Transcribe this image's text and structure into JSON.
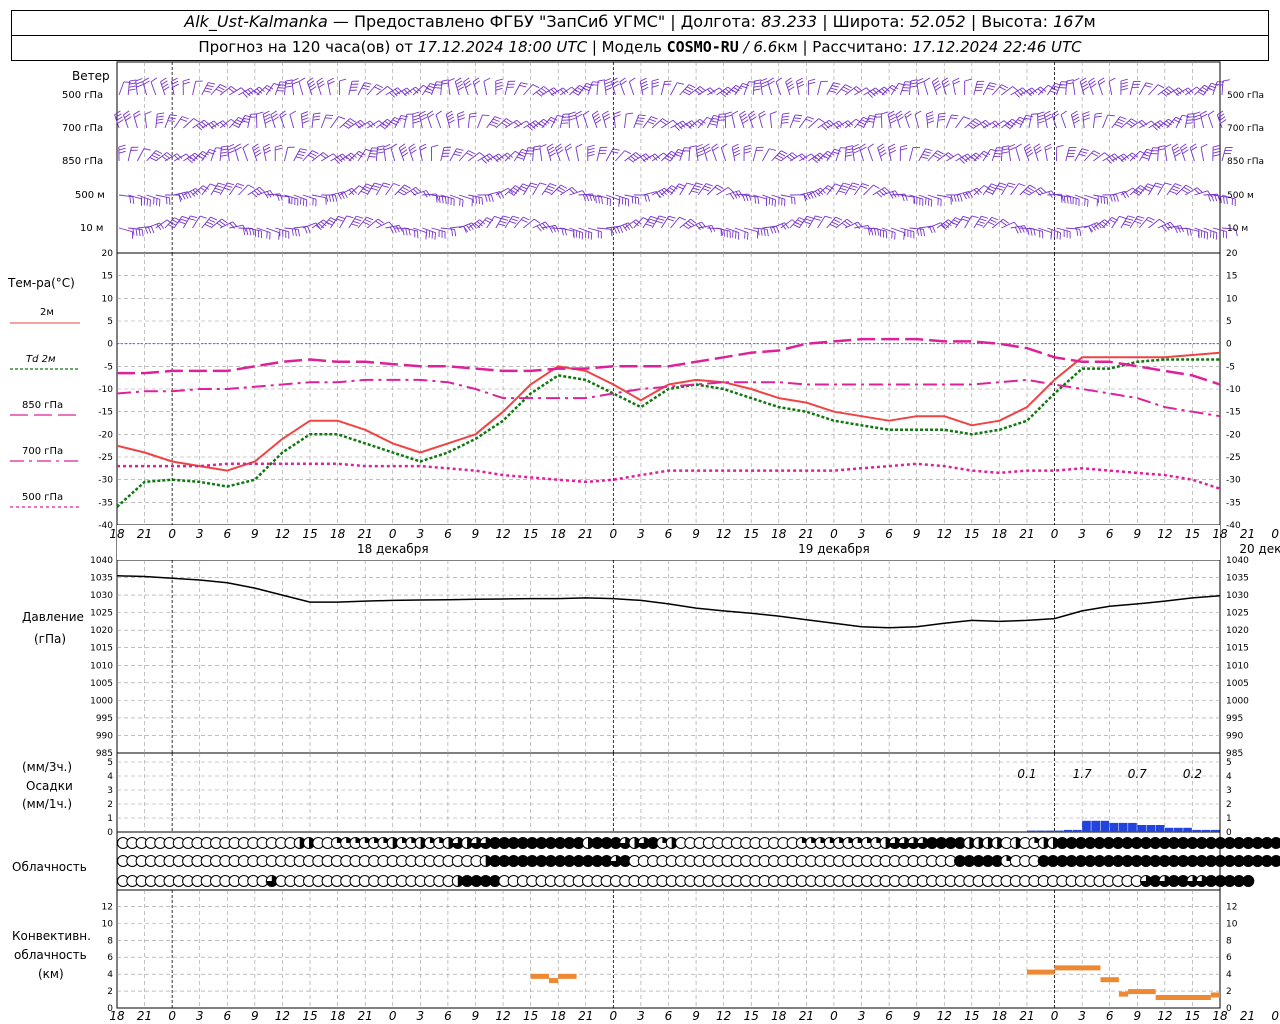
{
  "header": {
    "station": "Alk_Ust-Kalmanka",
    "provider": "— Предоставлено ФГБУ \"ЗапСиб УГМС\" |",
    "lon_label": "Долгота:",
    "lon_value": "83.233",
    "lat_label": "| Широта:",
    "lat_value": "52.052",
    "alt_label": "| Высота:",
    "alt_value": "167",
    "alt_unit": "м",
    "forecast_prefix": "Прогноз на 120 часа(ов) от",
    "forecast_time": "17.12.2024 18:00 UTC",
    "model_label": "| Модель",
    "model_name": "COSMO-RU",
    "model_res": "/ 6.6",
    "model_unit": "км",
    "calc_label": "| Рассчитано:",
    "calc_time": "17.12.2024 22:46 UTC"
  },
  "labels": {
    "wind_title": "Ветер",
    "wind_levels": [
      "500 гПа",
      "700 гПа",
      "850 гПа",
      "500 м",
      "10 м"
    ],
    "temp_title": "Тем-ра(°С)",
    "temp_legend": [
      "2м",
      "Td 2м",
      "850 гПа",
      "700 гПа",
      "500 гПа"
    ],
    "pres_title": "Давление",
    "pres_unit": "(гПа)",
    "precip_unit1": "(мм/3ч.)",
    "precip_title": "Осадки",
    "precip_unit2": "(мм/1ч.)",
    "cloud_title": "Облачность",
    "conv_title1": "Конвективн.",
    "conv_title2": "облачность",
    "conv_unit": "(км)"
  },
  "colors": {
    "t2m": "#ee4444",
    "td2m": "#117711",
    "t850": "#dd2299",
    "t700": "#dd2299",
    "t500": "#dd2299",
    "wind": "#7733cc",
    "precip": "#2244dd",
    "conv": "#ee8833",
    "zero": "#3355dd"
  },
  "chart_data": [
    {
      "type": "line",
      "name": "temperature",
      "x_hours": [
        0,
        3,
        6,
        9,
        12,
        15,
        18,
        21,
        24,
        27,
        30,
        33,
        36,
        39,
        42,
        45,
        48,
        51,
        54,
        57,
        60,
        63,
        66,
        69,
        72,
        75,
        78,
        81,
        84,
        87,
        90,
        93,
        96,
        99,
        102,
        105,
        108,
        111,
        114,
        117,
        120
      ],
      "x_tick_labels": [
        "18",
        "21",
        "0",
        "3",
        "6",
        "9",
        "12",
        "15",
        "18",
        "21",
        "0",
        "3",
        "6",
        "9",
        "12",
        "15",
        "18",
        "21",
        "0",
        "3",
        "6",
        "9",
        "12",
        "15",
        "18",
        "21",
        "0",
        "3",
        "6",
        "9",
        "12",
        "15",
        "18",
        "21",
        "0",
        "3",
        "6",
        "9",
        "12",
        "15",
        "18",
        "21",
        "0"
      ],
      "date_labels": [
        "18 декабря",
        "19 декабря",
        "20 декабря"
      ],
      "ylim": [
        -40,
        20
      ],
      "yticks": [
        20,
        15,
        10,
        5,
        0,
        -5,
        -10,
        -15,
        -20,
        -25,
        -30,
        -35,
        -40
      ],
      "series": [
        {
          "name": "2м",
          "values": [
            -22.5,
            -24,
            -26,
            -27,
            -28,
            -26,
            -21,
            -17,
            -17,
            -19,
            -22,
            -24,
            -22,
            -20,
            -15,
            -9,
            -5,
            -6,
            -9,
            -12.5,
            -9,
            -8,
            -8.5,
            -10,
            -12,
            -13,
            -15,
            -16,
            -17,
            -16,
            -16,
            -18,
            -17,
            -14,
            -8,
            -3,
            -3,
            -3,
            -3,
            -2.5,
            -2
          ]
        },
        {
          "name": "Td 2м",
          "values": [
            -36,
            -30.5,
            -30,
            -30.5,
            -31.5,
            -30,
            -24,
            -20,
            -20,
            -22,
            -24,
            -26,
            -24,
            -21,
            -17,
            -11,
            -7,
            -8,
            -11,
            -14,
            -10,
            -9,
            -10,
            -12,
            -14,
            -15,
            -17,
            -18,
            -19,
            -19,
            -19,
            -20,
            -19,
            -17,
            -11,
            -5.5,
            -5.5,
            -4,
            -3.5,
            -3.5,
            -3.5
          ]
        },
        {
          "name": "850 гПа",
          "values": [
            -6.5,
            -6.5,
            -6,
            -6,
            -6,
            -5,
            -4,
            -3.5,
            -4,
            -4,
            -4.5,
            -5,
            -5,
            -5.5,
            -6,
            -6,
            -5.5,
            -5.5,
            -5,
            -5,
            -5,
            -4,
            -3,
            -2,
            -1.5,
            0,
            0.5,
            1,
            1,
            1,
            0.5,
            0.5,
            0,
            -1,
            -3,
            -4,
            -4,
            -5,
            -6,
            -7,
            -9
          ]
        },
        {
          "name": "700 гПа",
          "values": [
            -11,
            -10.5,
            -10.5,
            -10,
            -10,
            -9.5,
            -9,
            -8.5,
            -8.5,
            -8,
            -8,
            -8,
            -8.5,
            -10,
            -12,
            -12,
            -12,
            -12,
            -11,
            -10,
            -9.5,
            -9,
            -8.5,
            -8.5,
            -8.5,
            -9,
            -9,
            -9,
            -9,
            -9,
            -9,
            -9,
            -8.5,
            -8,
            -9,
            -10,
            -11,
            -12,
            -14,
            -15,
            -16
          ]
        },
        {
          "name": "500 гПа",
          "values": [
            -27,
            -27,
            -27,
            -27,
            -26.5,
            -26.5,
            -26.5,
            -26.5,
            -26.5,
            -27,
            -27,
            -27,
            -27.5,
            -28,
            -29,
            -29.5,
            -30,
            -30.5,
            -30,
            -29,
            -28,
            -28,
            -28,
            -28,
            -28,
            -28,
            -28,
            -27.5,
            -27,
            -26.5,
            -27,
            -28,
            -28.5,
            -28,
            -28,
            -27.5,
            -28,
            -28.5,
            -29,
            -30,
            -32
          ]
        }
      ]
    },
    {
      "type": "line",
      "name": "pressure",
      "x_hours": [
        0,
        3,
        6,
        9,
        12,
        15,
        18,
        21,
        24,
        27,
        30,
        33,
        36,
        39,
        42,
        45,
        48,
        51,
        54,
        57,
        60,
        63,
        66,
        69,
        72,
        75,
        78,
        81,
        84,
        87,
        90,
        93,
        96,
        99,
        102,
        105,
        108,
        111,
        114,
        117,
        120
      ],
      "ylim": [
        985,
        1040
      ],
      "yticks": [
        1040,
        1035,
        1030,
        1025,
        1020,
        1015,
        1010,
        1005,
        1000,
        995,
        990,
        985
      ],
      "series": [
        {
          "name": "Давление",
          "values": [
            1035.5,
            1035.3,
            1034.8,
            1034.3,
            1033.5,
            1032,
            1030,
            1028,
            1028,
            1028.3,
            1028.5,
            1028.6,
            1028.7,
            1028.8,
            1028.9,
            1029,
            1029,
            1029.2,
            1029,
            1028.5,
            1027.5,
            1026.3,
            1025.5,
            1024.8,
            1024,
            1023,
            1022,
            1021,
            1020.7,
            1021,
            1022,
            1022.8,
            1022.5,
            1022.8,
            1023.3,
            1025.5,
            1026.8,
            1027.5,
            1028.3,
            1029.2,
            1029.8
          ]
        }
      ]
    },
    {
      "type": "bar",
      "name": "precipitation",
      "ylim": [
        0,
        5
      ],
      "yticks": [
        5,
        4,
        3,
        2,
        1,
        0
      ],
      "x_hours": [
        96,
        97,
        98,
        99,
        100,
        101,
        102,
        103,
        104,
        105,
        106,
        107,
        108,
        109,
        110,
        111,
        112,
        113,
        114,
        115,
        116,
        117,
        118,
        119
      ],
      "values": [
        0.05,
        0.05,
        0.05,
        0.1,
        0.1,
        0.1,
        0.1,
        0.15,
        0.15,
        0.8,
        0.8,
        0.8,
        0.65,
        0.65,
        0.65,
        0.5,
        0.5,
        0.5,
        0.3,
        0.3,
        0.3,
        0.15,
        0.15,
        0.15
      ],
      "period_totals": [
        {
          "hour": 99,
          "value": "0.1"
        },
        {
          "hour": 105,
          "value": "1.7"
        },
        {
          "hour": 111,
          "value": "0.7"
        },
        {
          "hour": 117,
          "value": "0.2"
        }
      ]
    },
    {
      "type": "table",
      "name": "cloud_cover",
      "description_rows": [
        "upper",
        "middle",
        "lower"
      ],
      "fraction_per_hour": [
        [
          0,
          0,
          0,
          0,
          0,
          0,
          0,
          0,
          0,
          0,
          0,
          0,
          0,
          0,
          0,
          0,
          0,
          0,
          0,
          0.5,
          0.5,
          0,
          0,
          0.25,
          0.25,
          0.25,
          0.25,
          0.25,
          0.25,
          0.5,
          0.25,
          0.25,
          0.5,
          0.25,
          0.25,
          0.5,
          0.75,
          0.5,
          0.75,
          0.75,
          1,
          1,
          1,
          1,
          1,
          1,
          1,
          1,
          1,
          1,
          0.5,
          1,
          1,
          1,
          0.75,
          0.5,
          0.75,
          1,
          0.25,
          0.5,
          0,
          0,
          0,
          0,
          0,
          0,
          0,
          0,
          0,
          0,
          0,
          0,
          0,
          0.25,
          0.25,
          0.25,
          0.25,
          0.25,
          0.25,
          0.25,
          0.25,
          0.25,
          0.5,
          0.75,
          0.75,
          0.75,
          0.75,
          1,
          1,
          1,
          1,
          0.5,
          0.5,
          0.5,
          0.5,
          0,
          0.5,
          0,
          0.25,
          0.5,
          0.5,
          1,
          1,
          1,
          1,
          1,
          1,
          1,
          1,
          1,
          1,
          1,
          1,
          1,
          1,
          1,
          1,
          1,
          1,
          1,
          1,
          1,
          1,
          1,
          1,
          0.5
        ],
        [
          0,
          0,
          0,
          0,
          0,
          0,
          0,
          0,
          0,
          0,
          0,
          0,
          0,
          0,
          0,
          0,
          0,
          0,
          0,
          0,
          0,
          0,
          0,
          0,
          0,
          0,
          0,
          0,
          0,
          0,
          0,
          0,
          0,
          0,
          0,
          0,
          0,
          0,
          0,
          0.5,
          1,
          1,
          1,
          1,
          1,
          1,
          1,
          1,
          1,
          1,
          1,
          1,
          1,
          0.75,
          1,
          0,
          0,
          0,
          0,
          0,
          0,
          0,
          0,
          0,
          0,
          0,
          0,
          0,
          0,
          0,
          0,
          0,
          0,
          0,
          0,
          0,
          0,
          0,
          0,
          0,
          0,
          0,
          0,
          0,
          0,
          0,
          0,
          0,
          0,
          0,
          1,
          1,
          1,
          1,
          1,
          0.25,
          0,
          0,
          0,
          1,
          1,
          1,
          1,
          1,
          1,
          1,
          1,
          1,
          1,
          1,
          1,
          1,
          1,
          1,
          1,
          1,
          1,
          1,
          1,
          1,
          1,
          1,
          1,
          1,
          1,
          1
        ],
        [
          0,
          0,
          0,
          0,
          0,
          0,
          0,
          0,
          0,
          0,
          0,
          0,
          0,
          0,
          0,
          0,
          0.75,
          0,
          0,
          0,
          0,
          0,
          0,
          0,
          0,
          0,
          0,
          0,
          0,
          0,
          0,
          0,
          0,
          0,
          0,
          0,
          0.5,
          1,
          1,
          1,
          1,
          0,
          0,
          0,
          0,
          0,
          0,
          0,
          0,
          0,
          0,
          0,
          0,
          0,
          0,
          0,
          0,
          0,
          0,
          0,
          0,
          0,
          0,
          0,
          0,
          0,
          0,
          0,
          0,
          0,
          0,
          0,
          0,
          0,
          0,
          0,
          0,
          0,
          0,
          0,
          0,
          0,
          0,
          0,
          0,
          0,
          0,
          0,
          0,
          0,
          0,
          0,
          0,
          0,
          0,
          0,
          0,
          0,
          0,
          0,
          0,
          0,
          0,
          0,
          0,
          0,
          0,
          0,
          0,
          0,
          0.75,
          1,
          0.75,
          1,
          1,
          0.75,
          0.75,
          1,
          1,
          1,
          1,
          1
        ]
      ]
    },
    {
      "type": "bar",
      "name": "convective_cloud",
      "ylim": [
        0,
        13
      ],
      "yticks": [
        12,
        10,
        8,
        6,
        4,
        2,
        0
      ],
      "segments": [
        {
          "start": 45,
          "end": 47,
          "value": 3.8
        },
        {
          "start": 47,
          "end": 48,
          "value": 3.3
        },
        {
          "start": 48,
          "end": 50,
          "value": 3.8
        },
        {
          "start": 99,
          "end": 102,
          "value": 4.3
        },
        {
          "start": 102,
          "end": 107,
          "value": 4.8
        },
        {
          "start": 107,
          "end": 109,
          "value": 3.4
        },
        {
          "start": 109,
          "end": 110,
          "value": 1.7
        },
        {
          "start": 110,
          "end": 113,
          "value": 2
        },
        {
          "start": 113,
          "end": 119,
          "value": 1.3
        },
        {
          "start": 119,
          "end": 120,
          "value": 1.6
        }
      ]
    }
  ]
}
